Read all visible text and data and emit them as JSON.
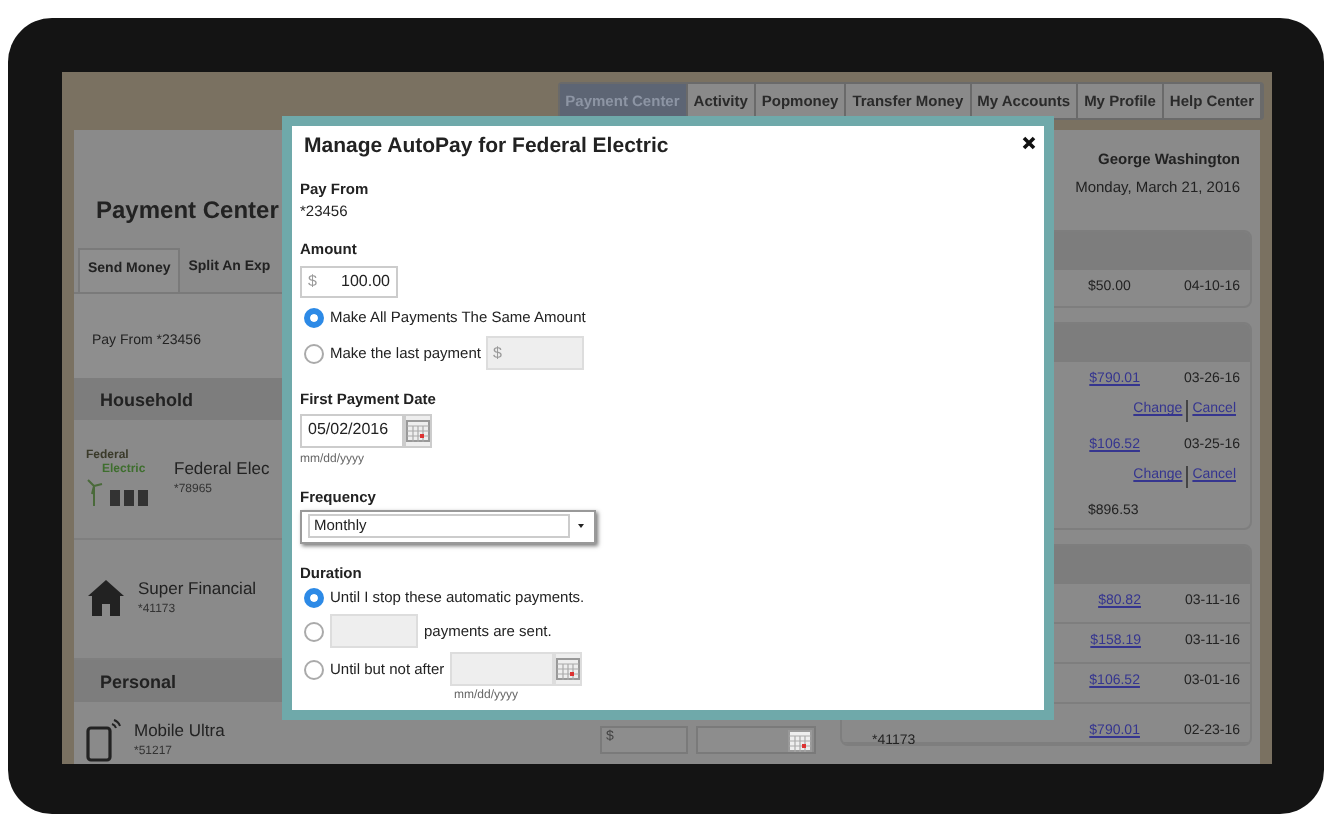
{
  "nav_tabs": [
    {
      "label": "Payment Center",
      "selected": true
    },
    {
      "label": "Activity",
      "selected": false
    },
    {
      "label": "Popmoney",
      "selected": false
    },
    {
      "label": "Transfer Money",
      "selected": false
    },
    {
      "label": "My Accounts",
      "selected": false
    },
    {
      "label": "My Profile",
      "selected": false
    },
    {
      "label": "Help Center",
      "selected": false
    }
  ],
  "page": {
    "title": "Payment Center",
    "action_tabs": [
      {
        "label": "Send Money",
        "selected": true
      },
      {
        "label": "Split An Exp",
        "selected": false
      }
    ],
    "pay_from": "Pay From *23456",
    "groups": [
      {
        "name": "Household",
        "payees": [
          {
            "name": "Federal Elec",
            "account": "*78965",
            "kind": "electric",
            "logo_lines": [
              "Federal",
              "Electric"
            ]
          },
          {
            "name": "Super Financial",
            "account": "*41173",
            "kind": "house"
          }
        ]
      },
      {
        "name": "Personal",
        "payees": [
          {
            "name": "Mobile Ultra",
            "account": "*51217",
            "kind": "tablet"
          }
        ]
      }
    ]
  },
  "pay_row": {
    "amount_placeholder": "$"
  },
  "user": {
    "name": "George Washington",
    "date": "Monday, March 21, 2016"
  },
  "payment_cards": [
    {
      "rows": [
        {
          "amount": "$50.00",
          "date": "04-10-16",
          "link": false
        }
      ]
    },
    {
      "rows": [
        {
          "amount": "$790.01",
          "date": "03-26-16",
          "link": true,
          "actions": [
            "Change",
            "Cancel"
          ]
        },
        {
          "amount": "$106.52",
          "date": "03-25-16",
          "link": true,
          "actions": [
            "Change",
            "Cancel"
          ]
        },
        {
          "amount": "$896.53",
          "link": false
        }
      ]
    },
    {
      "rows": [
        {
          "amount": "$80.82",
          "date": "03-11-16",
          "link": true
        },
        {
          "amount": "$158.19",
          "date": "03-11-16",
          "link": true
        },
        {
          "amount": "$106.52",
          "date": "03-01-16",
          "link": true
        },
        {
          "amount": "$790.01",
          "date": "02-23-16",
          "link": true,
          "note": "*41173"
        }
      ]
    }
  ],
  "modal": {
    "title": "Manage AutoPay for Federal Electric",
    "pay_from_label": "Pay From",
    "pay_from": "*23456",
    "amount_label": "Amount",
    "currency": "$",
    "amount": "100.00",
    "amount_options": [
      {
        "kind": "plain",
        "label": "Make All Payments The Same Amount",
        "selected": true
      },
      {
        "kind": "amount",
        "label": "Make the last payment",
        "placeholder": "$",
        "selected": false
      }
    ],
    "date_label": "First Payment Date",
    "date": "05/02/2016",
    "date_hint": "mm/dd/yyyy",
    "frequency_label": "Frequency",
    "frequency": "Monthly",
    "duration_label": "Duration",
    "duration_options": [
      {
        "kind": "plain",
        "label": "Until I stop these automatic payments.",
        "selected": true
      },
      {
        "kind": "count",
        "label": "payments are sent.",
        "selected": false
      },
      {
        "kind": "date",
        "label": "Until but not after",
        "hint": "mm/dd/yyyy",
        "selected": false
      }
    ]
  }
}
